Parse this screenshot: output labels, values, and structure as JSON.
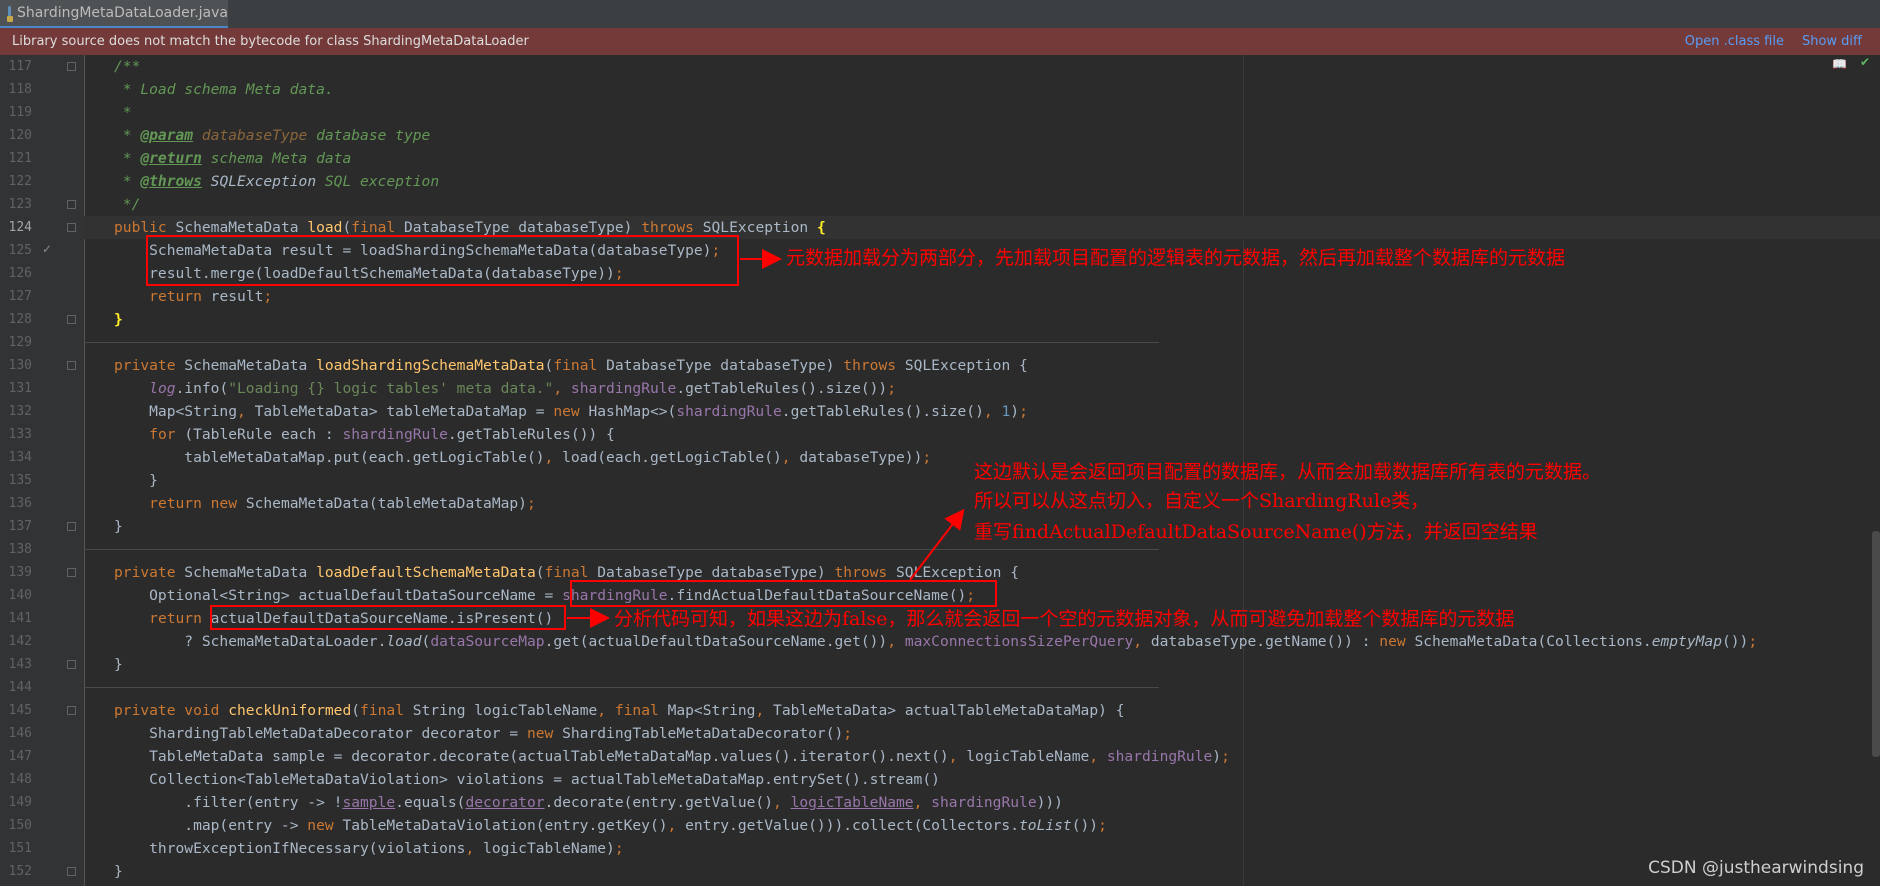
{
  "tab": {
    "title": "ShardingMetaDataLoader.java"
  },
  "banner": {
    "message": "Library source does not match the bytecode for class ShardingMetaDataLoader",
    "open_class": "Open .class file",
    "show_diff": "Show diff"
  },
  "editor": {
    "current_line": "124",
    "lines": [
      {
        "n": "117",
        "html": "<span class=\"cm\">/**</span>"
      },
      {
        "n": "118",
        "html": "<span class=\"cm\"> * Load schema Meta data.</span>"
      },
      {
        "n": "119",
        "html": "<span class=\"cm\"> *</span>"
      },
      {
        "n": "120",
        "html": "<span class=\"cm\"> * </span><span class=\"tg\">@param</span><span class=\"cm\"> </span><span class=\"tp\">databaseType</span><span class=\"cm\"> database type</span>"
      },
      {
        "n": "121",
        "html": "<span class=\"cm\"> * </span><span class=\"tg\">@return</span><span class=\"cm\"> schema Meta data</span>"
      },
      {
        "n": "122",
        "html": "<span class=\"cm\"> * </span><span class=\"tg\">@throws</span><span class=\"cm\"> </span><span class=\"cm\" style=\"color:#a9b7c6\">SQLException</span><span class=\"cm\"> SQL exception</span>"
      },
      {
        "n": "123",
        "html": "<span class=\"cm\"> */</span>"
      },
      {
        "n": "124",
        "html": "<span class=\"kw\">public </span>SchemaMetaData <span class=\"fn\">load</span>(<span class=\"kw\">final </span>DatabaseType databaseType) <span class=\"kw\">throws </span>SQLException <span style=\"color:#ffef28;font-weight:bold\">{</span>"
      },
      {
        "n": "125",
        "html": "    SchemaMetaData result = loadShardingSchemaMetaData(databaseType)<span class=\"kw\">;</span>"
      },
      {
        "n": "126",
        "html": "    result.merge(loadDefaultSchemaMetaData(databaseType))<span class=\"kw\">;</span>"
      },
      {
        "n": "127",
        "html": "    <span class=\"kw\">return </span>result<span class=\"kw\">;</span>"
      },
      {
        "n": "128",
        "html": "<span style=\"color:#ffef28;font-weight:bold\">}</span>"
      },
      {
        "n": "129",
        "html": ""
      },
      {
        "n": "130",
        "html": "<span class=\"kw\">private </span>SchemaMetaData <span class=\"fn\">loadShardingSchemaMetaData</span>(<span class=\"kw\">final </span>DatabaseType databaseType) <span class=\"kw\">throws </span>SQLException {"
      },
      {
        "n": "131",
        "html": "    <span class=\"fld it\">log</span>.info(<span class=\"st\">\"Loading {} logic tables' meta data.\"</span><span class=\"kw\">, </span><span class=\"fld\">shardingRule</span>.getTableRules().size())<span class=\"kw\">;</span>"
      },
      {
        "n": "132",
        "html": "    Map&lt;String<span class=\"kw\">, </span>TableMetaData&gt; tableMetaDataMap = <span class=\"kw\">new </span>HashMap&lt;&gt;(<span class=\"fld\">shardingRule</span>.getTableRules().size()<span class=\"kw\">, </span><span class=\"nm\">1</span>)<span class=\"kw\">;</span>"
      },
      {
        "n": "133",
        "html": "    <span class=\"kw\">for </span>(TableRule each : <span class=\"fld\">shardingRule</span>.getTableRules()) {"
      },
      {
        "n": "134",
        "html": "        tableMetaDataMap.put(each.getLogicTable()<span class=\"kw\">, </span>load(each.getLogicTable()<span class=\"kw\">, </span>databaseType))<span class=\"kw\">;</span>"
      },
      {
        "n": "135",
        "html": "    }"
      },
      {
        "n": "136",
        "html": "    <span class=\"kw\">return new </span>SchemaMetaData(tableMetaDataMap)<span class=\"kw\">;</span>"
      },
      {
        "n": "137",
        "html": "}"
      },
      {
        "n": "138",
        "html": ""
      },
      {
        "n": "139",
        "html": "<span class=\"kw\">private </span>SchemaMetaData <span class=\"fn\">loadDefaultSchemaMetaData</span>(<span class=\"kw\">final </span>DatabaseType databaseType) <span class=\"kw\">throws </span>SQLException {"
      },
      {
        "n": "140",
        "html": "    Optional&lt;String&gt; actualDefaultDataSourceName = <span class=\"fld\">shardingRule</span>.findActualDefaultDataSourceName()<span class=\"kw\">;</span>"
      },
      {
        "n": "141",
        "html": "    <span class=\"kw\">return </span>actualDefaultDataSourceName.isPresent()"
      },
      {
        "n": "142",
        "html": "        ? SchemaMetaDataLoader.<span class=\"it\">load</span>(<span class=\"fld\">dataSourceMap</span>.get(actualDefaultDataSourceName.get())<span class=\"kw\">, </span><span class=\"fld\">maxConnectionsSizePerQuery</span><span class=\"kw\">, </span>databaseType.getName()) : <span class=\"kw\">new </span>SchemaMetaData(Collections.<span class=\"it\">emptyMap</span>())<span class=\"kw\">;</span>"
      },
      {
        "n": "143",
        "html": "}"
      },
      {
        "n": "144",
        "html": ""
      },
      {
        "n": "145",
        "html": "<span class=\"kw\">private void </span><span class=\"fn\">checkUniformed</span>(<span class=\"kw\">final </span>String logicTableName<span class=\"kw\">, final </span>Map&lt;String<span class=\"kw\">, </span>TableMetaData&gt; actualTableMetaDataMap) {"
      },
      {
        "n": "146",
        "html": "    ShardingTableMetaDataDecorator decorator = <span class=\"kw\">new </span>ShardingTableMetaDataDecorator()<span class=\"kw\">;</span>"
      },
      {
        "n": "147",
        "html": "    TableMetaData sample = decorator.decorate(actualTableMetaDataMap.values().iterator().next()<span class=\"kw\">, </span>logicTableName<span class=\"kw\">, </span><span class=\"fld\">shardingRule</span>)<span class=\"kw\">;</span>"
      },
      {
        "n": "148",
        "html": "    Collection&lt;TableMetaDataViolation&gt; violations = actualTableMetaDataMap.entrySet().stream()"
      },
      {
        "n": "149",
        "html": "        .filter(entry -&gt; !<span class=\"fld ul\">sample</span>.equals(<span class=\"fld ul\">decorator</span>.decorate(entry.getValue()<span class=\"kw\">, </span><span class=\"fld ul\">logicTableName</span><span class=\"kw\">, </span><span class=\"fld\">shardingRule</span>)))"
      },
      {
        "n": "150",
        "html": "        .map(entry -&gt; <span class=\"kw\">new </span>TableMetaDataViolation(entry.getKey()<span class=\"kw\">, </span>entry.getValue())).collect(Collectors.<span class=\"it\">toList</span>())<span class=\"kw\">;</span>"
      },
      {
        "n": "151",
        "html": "    throwExceptionIfNecessary(violations<span class=\"kw\">, </span>logicTableName)<span class=\"kw\">;</span>"
      },
      {
        "n": "152",
        "html": "}"
      }
    ]
  },
  "annotations": {
    "note1": "元数据加载分为两部分，先加载项目配置的逻辑表的元数据，然后再加载整个数据库的元数据",
    "note2_line1": "这边默认是会返回项目配置的数据库，从而会加载数据库所有表的元数据。",
    "note2_line2": "所以可以从这点切入，自定义一个ShardingRule类，",
    "note2_line3": "重写findActualDefaultDataSourceName()方法，并返回空结果",
    "note3": "分析代码可知，如果这边为false，那么就会返回一个空的元数据对象，从而可避免加载整个数据库的元数据"
  },
  "watermark": "CSDN @justhearwindsing",
  "colors": {
    "annotation": "#ff0000",
    "banner_bg": "#743a3a",
    "editor_bg": "#2b2b2b"
  },
  "icons": [
    "java-class-icon",
    "reader-mode-icon",
    "inspection-ok-icon",
    "bookmark-check-icon"
  ]
}
